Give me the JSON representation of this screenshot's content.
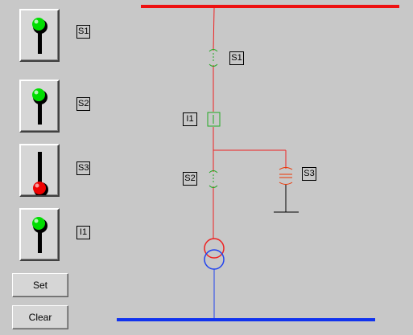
{
  "switches": [
    {
      "id": "s1",
      "label": "S1",
      "state": "on",
      "lamp_color": "#00dd00"
    },
    {
      "id": "s2",
      "label": "S2",
      "state": "on",
      "lamp_color": "#00dd00"
    },
    {
      "id": "s3",
      "label": "S3",
      "state": "off",
      "lamp_color": "#ee0000"
    },
    {
      "id": "i1",
      "label": "I1",
      "state": "on",
      "lamp_color": "#00dd00"
    }
  ],
  "buttons": {
    "set_label": "Set",
    "clear_label": "Clear"
  },
  "diagram": {
    "labels": {
      "s1": "S1",
      "i1": "I1",
      "s2": "S2",
      "s3": "S3"
    },
    "colors": {
      "top_bus": "#ee1111",
      "bottom_bus": "#1133ee",
      "red_wire": "#ee2222",
      "blue_wire": "#2244ee",
      "disconnector": "#22aa22",
      "breaker": "#22aa22",
      "earth_switch": "#ee3300",
      "ground": "#000000"
    }
  }
}
